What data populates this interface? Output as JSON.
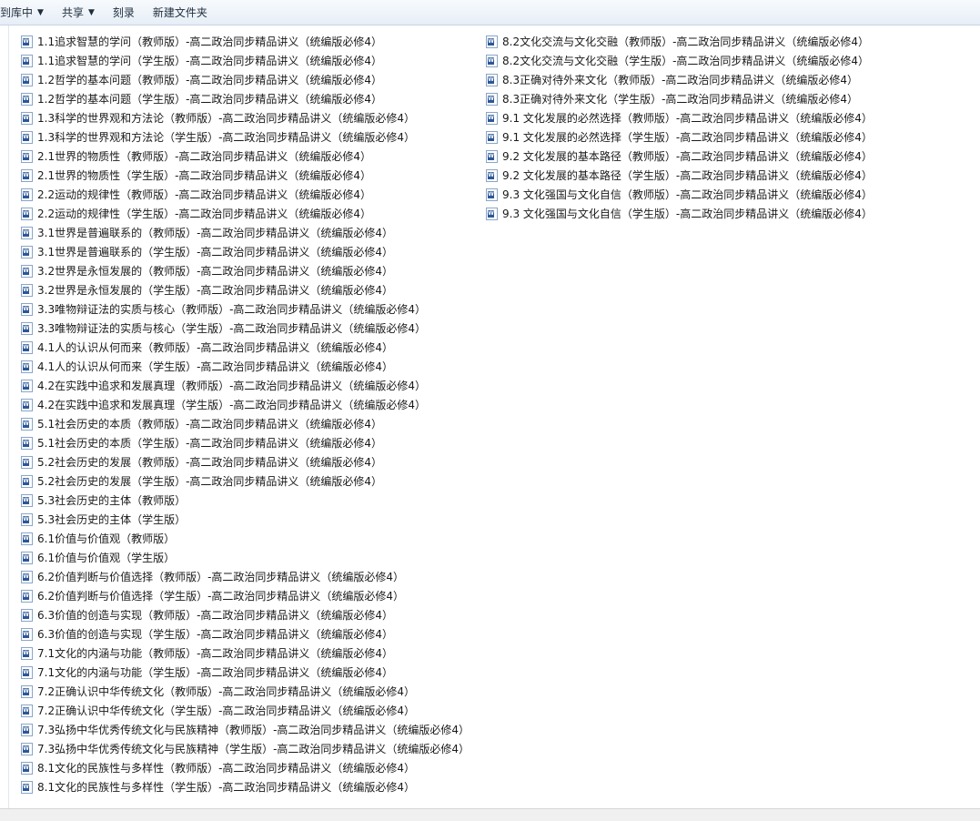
{
  "toolbar": {
    "library_label": "到库中",
    "share_label": "共享",
    "burn_label": "刻录",
    "new_folder_label": "新建文件夹"
  },
  "files_left": [
    "1.1追求智慧的学问（教师版）-高二政治同步精品讲义（统编版必修4）",
    "1.1追求智慧的学问（学生版）-高二政治同步精品讲义（统编版必修4）",
    "1.2哲学的基本问题（教师版）-高二政治同步精品讲义（统编版必修4）",
    "1.2哲学的基本问题（学生版）-高二政治同步精品讲义（统编版必修4）",
    "1.3科学的世界观和方法论（教师版）-高二政治同步精品讲义（统编版必修4）",
    "1.3科学的世界观和方法论（学生版）-高二政治同步精品讲义（统编版必修4）",
    "2.1世界的物质性（教师版）-高二政治同步精品讲义（统编版必修4）",
    "2.1世界的物质性（学生版）-高二政治同步精品讲义（统编版必修4）",
    "2.2运动的规律性（教师版）-高二政治同步精品讲义（统编版必修4）",
    "2.2运动的规律性（学生版）-高二政治同步精品讲义（统编版必修4）",
    "3.1世界是普遍联系的（教师版）-高二政治同步精品讲义（统编版必修4）",
    "3.1世界是普遍联系的（学生版）-高二政治同步精品讲义（统编版必修4）",
    "3.2世界是永恒发展的（教师版）-高二政治同步精品讲义（统编版必修4）",
    "3.2世界是永恒发展的（学生版）-高二政治同步精品讲义（统编版必修4）",
    "3.3唯物辩证法的实质与核心（教师版）-高二政治同步精品讲义（统编版必修4）",
    "3.3唯物辩证法的实质与核心（学生版）-高二政治同步精品讲义（统编版必修4）",
    "4.1人的认识从何而来（教师版）-高二政治同步精品讲义（统编版必修4）",
    "4.1人的认识从何而来（学生版）-高二政治同步精品讲义（统编版必修4）",
    "4.2在实践中追求和发展真理（教师版）-高二政治同步精品讲义（统编版必修4）",
    "4.2在实践中追求和发展真理（学生版）-高二政治同步精品讲义（统编版必修4）",
    "5.1社会历史的本质（教师版）-高二政治同步精品讲义（统编版必修4）",
    "5.1社会历史的本质（学生版）-高二政治同步精品讲义（统编版必修4）",
    "5.2社会历史的发展（教师版）-高二政治同步精品讲义（统编版必修4）",
    "5.2社会历史的发展（学生版）-高二政治同步精品讲义（统编版必修4）",
    "5.3社会历史的主体（教师版）",
    "5.3社会历史的主体（学生版）",
    "6.1价值与价值观（教师版）",
    "6.1价值与价值观（学生版）",
    "6.2价值判断与价值选择（教师版）-高二政治同步精品讲义（统编版必修4）",
    "6.2价值判断与价值选择（学生版）-高二政治同步精品讲义（统编版必修4）",
    "6.3价值的创造与实现（教师版）-高二政治同步精品讲义（统编版必修4）",
    "6.3价值的创造与实现（学生版）-高二政治同步精品讲义（统编版必修4）",
    "7.1文化的内涵与功能（教师版）-高二政治同步精品讲义（统编版必修4）",
    "7.1文化的内涵与功能（学生版）-高二政治同步精品讲义（统编版必修4）",
    "7.2正确认识中华传统文化（教师版）-高二政治同步精品讲义（统编版必修4）",
    "7.2正确认识中华传统文化（学生版）-高二政治同步精品讲义（统编版必修4）",
    "7.3弘扬中华优秀传统文化与民族精神（教师版）-高二政治同步精品讲义（统编版必修4）",
    "7.3弘扬中华优秀传统文化与民族精神（学生版）-高二政治同步精品讲义（统编版必修4）",
    "8.1文化的民族性与多样性（教师版）-高二政治同步精品讲义（统编版必修4）",
    "8.1文化的民族性与多样性（学生版）-高二政治同步精品讲义（统编版必修4）"
  ],
  "files_right": [
    "8.2文化交流与文化交融（教师版）-高二政治同步精品讲义（统编版必修4）",
    "8.2文化交流与文化交融（学生版）-高二政治同步精品讲义（统编版必修4）",
    "8.3正确对待外来文化（教师版）-高二政治同步精品讲义（统编版必修4）",
    "8.3正确对待外来文化（学生版）-高二政治同步精品讲义（统编版必修4）",
    "9.1 文化发展的必然选择（教师版）-高二政治同步精品讲义（统编版必修4）",
    "9.1 文化发展的必然选择（学生版）-高二政治同步精品讲义（统编版必修4）",
    "9.2 文化发展的基本路径（教师版）-高二政治同步精品讲义（统编版必修4）",
    "9.2 文化发展的基本路径（学生版）-高二政治同步精品讲义（统编版必修4）",
    "9.3 文化强国与文化自信（教师版）-高二政治同步精品讲义（统编版必修4）",
    "9.3 文化强国与文化自信（学生版）-高二政治同步精品讲义（统编版必修4）"
  ],
  "icons": {
    "file_icon": "word-document-icon",
    "dropdown_icon": "dropdown-arrow-icon"
  },
  "colors": {
    "toolbar_bg": "#e7eef7",
    "word_blue": "#2b5797"
  }
}
